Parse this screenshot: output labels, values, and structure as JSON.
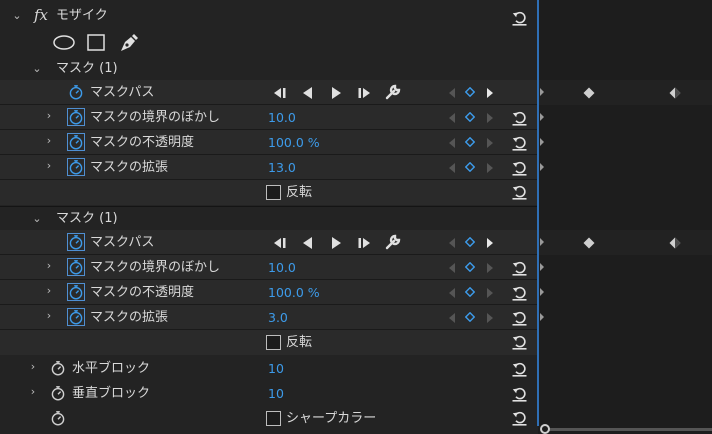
{
  "effect": {
    "fx_label": "fx",
    "name": "モザイク"
  },
  "shape_tools": [
    "ellipse-tool",
    "rectangle-tool",
    "pen-tool"
  ],
  "masks": [
    {
      "title": "マスク (1)",
      "path_label": "マスクパス",
      "feather_label": "マスクの境界のぼかし",
      "feather_value": "10.0",
      "opacity_label": "マスクの不透明度",
      "opacity_value": "100.0 %",
      "expansion_label": "マスクの拡張",
      "expansion_value": "13.0",
      "invert_label": "反転"
    },
    {
      "title": "マスク (1)",
      "path_label": "マスクパス",
      "feather_label": "マスクの境界のぼかし",
      "feather_value": "10.0",
      "opacity_label": "マスクの不透明度",
      "opacity_value": "100.0 %",
      "expansion_label": "マスクの拡張",
      "expansion_value": "3.0",
      "invert_label": "反転"
    }
  ],
  "horizontal_blocks": {
    "label": "水平ブロック",
    "value": "10"
  },
  "vertical_blocks": {
    "label": "垂直ブロック",
    "value": "10"
  },
  "sharp_colors": {
    "label": "シャープカラー"
  },
  "colors": {
    "value_blue": "#3d9bea",
    "accent_blue": "#4f8fd2",
    "panel": "#232323"
  }
}
